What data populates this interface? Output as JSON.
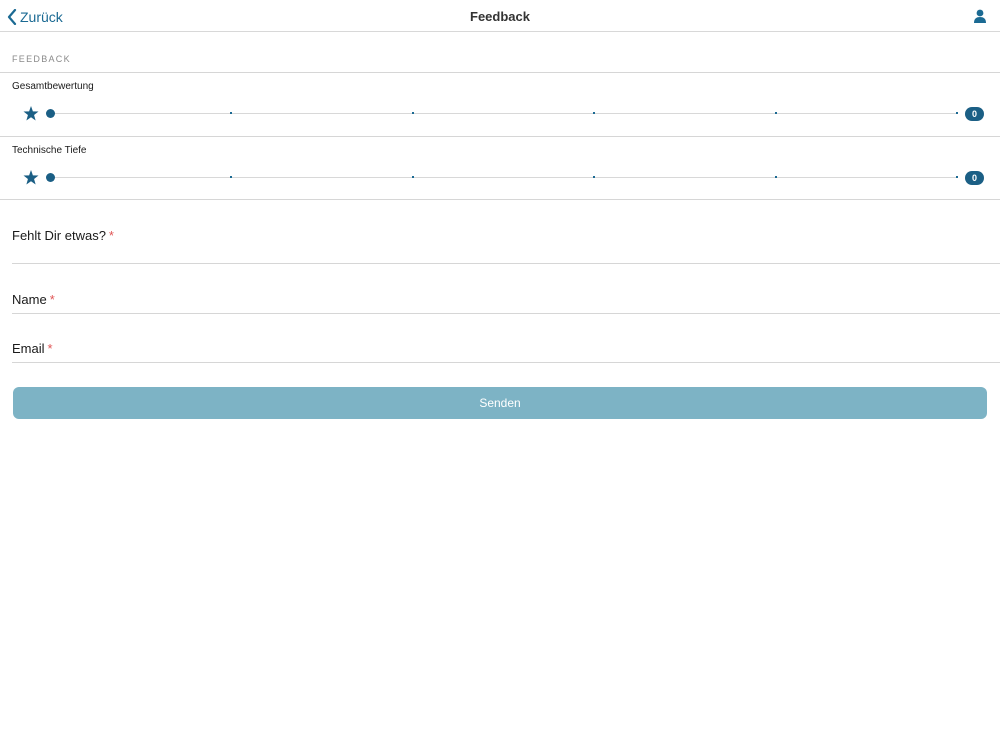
{
  "nav": {
    "back_label": "Zurück",
    "title": "Feedback"
  },
  "form": {
    "section_header": "FEEDBACK",
    "ratings": [
      {
        "label": "Gesamtbewertung",
        "value": "0"
      },
      {
        "label": "Technische Tiefe",
        "value": "0"
      }
    ],
    "fields": [
      {
        "label": "Fehlt Dir etwas?",
        "required_mark": "*",
        "value": ""
      },
      {
        "label": "Name",
        "required_mark": "*",
        "value": ""
      },
      {
        "label": "Email",
        "required_mark": "*",
        "value": ""
      }
    ],
    "submit_label": "Senden"
  },
  "colors": {
    "accent": "#1b5f85",
    "link": "#1b6a93",
    "button": "#7db3c5",
    "required": "#e05555"
  }
}
